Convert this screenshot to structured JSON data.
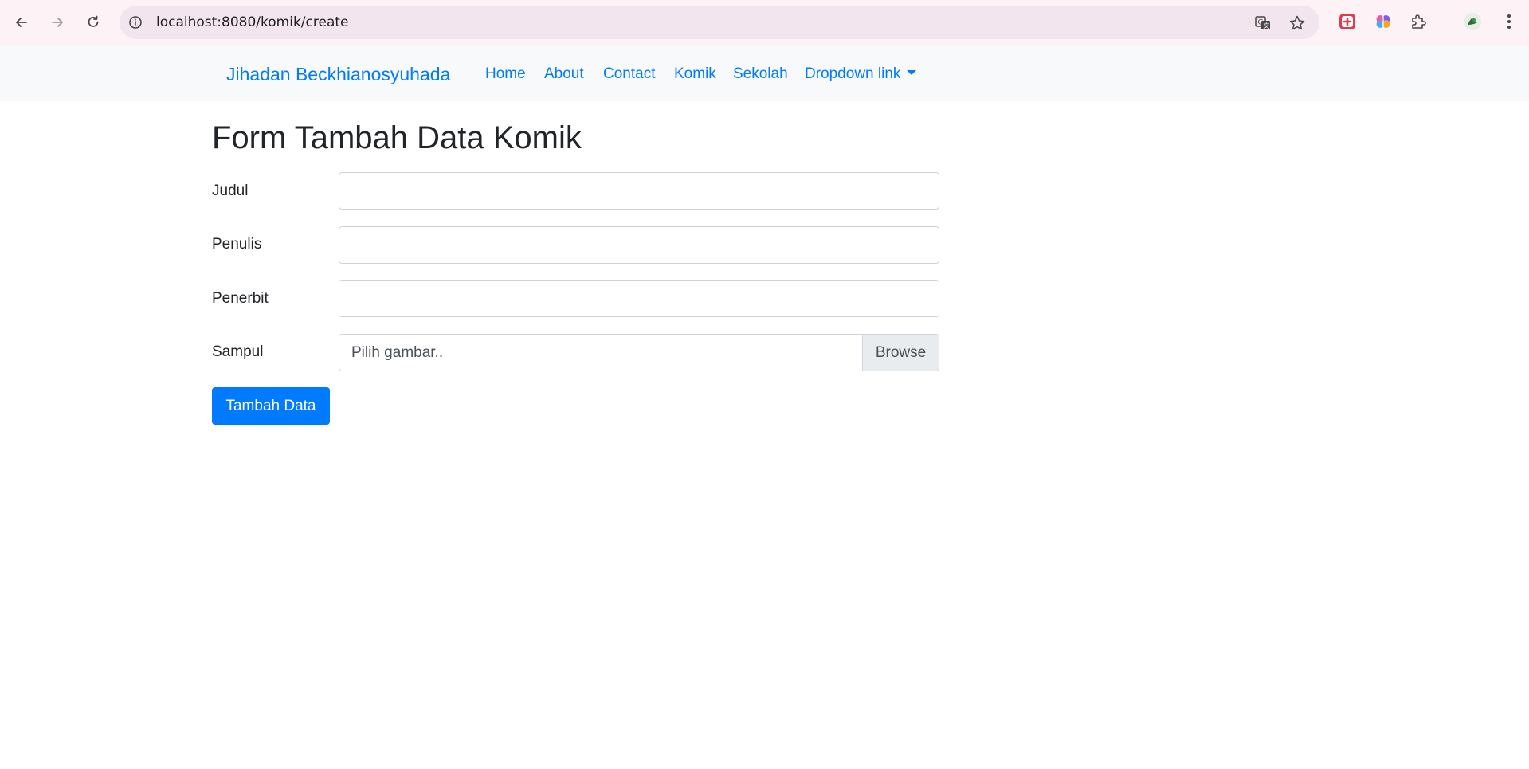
{
  "browser": {
    "url": "localhost:8080/komik/create",
    "back_icon": "back-arrow-icon",
    "forward_icon": "forward-arrow-icon",
    "reload_icon": "reload-icon",
    "info_icon": "site-info-icon",
    "translate_icon": "translate-icon",
    "bookmark_icon": "star-icon",
    "extensions": [
      "red-plus-extension-icon",
      "brain-extension-icon",
      "puzzle-extensions-icon",
      "profile-avatar-icon",
      "kebab-menu-icon"
    ]
  },
  "navbar": {
    "brand": "Jihadan Beckhianosyuhada",
    "links": [
      "Home",
      "About",
      "Contact",
      "Komik",
      "Sekolah"
    ],
    "dropdown": "Dropdown link"
  },
  "page": {
    "title": "Form Tambah Data Komik",
    "fields": {
      "judul": {
        "label": "Judul",
        "value": ""
      },
      "penulis": {
        "label": "Penulis",
        "value": ""
      },
      "penerbit": {
        "label": "Penerbit",
        "value": ""
      },
      "sampul": {
        "label": "Sampul",
        "placeholder": "Pilih gambar..",
        "browse_label": "Browse"
      }
    },
    "submit_label": "Tambah Data"
  },
  "colors": {
    "primary": "#007bff",
    "navbar_bg": "#f8f9fa",
    "chrome_bg": "#fdf3f7"
  }
}
